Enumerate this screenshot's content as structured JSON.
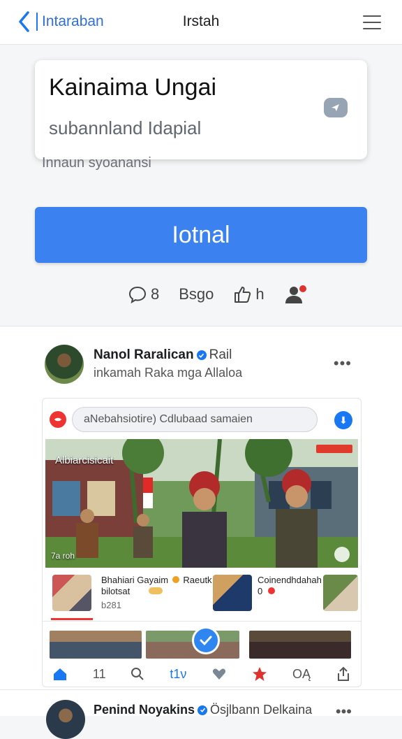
{
  "header": {
    "back_label": "Intaraban",
    "title": "Irstah"
  },
  "composer": {
    "heading": "Kainaima Ungai",
    "subheading": "subannland Idapial",
    "under_text": "Innaun syoanansi",
    "button_label": "Iotnal",
    "stats": {
      "comments": "8",
      "shares": "Bsgo",
      "likes": "h"
    }
  },
  "post": {
    "author": "Nanol Raralican",
    "author_tag": "Rail",
    "subtitle": "inkamah Raka mga Allaloa",
    "embed": {
      "search_text": "aNebahsiotire)  Cdlubaad samaien",
      "photo_caption_top": "Albiarcisicait",
      "photo_caption_bottom": "7a roh",
      "thumb_text_left_1": "Bhahiari Gayaim",
      "thumb_text_left_1b": "Raeutk",
      "thumb_text_left_2": "bilotsat",
      "thumb_text_left_3": "b281",
      "thumb_text_right_1": "Coinendhdahah",
      "thumb_text_right_2": "0"
    },
    "actions": {
      "retweet_count": "11",
      "repost_label": "t1ν",
      "bookmark_label": "OĄ"
    }
  },
  "post2": {
    "author": "Penind Noyakins",
    "author_tag": "Ösjlbann Delkaina"
  },
  "colors": {
    "accent": "#1877f2",
    "button": "#3b82f0"
  }
}
